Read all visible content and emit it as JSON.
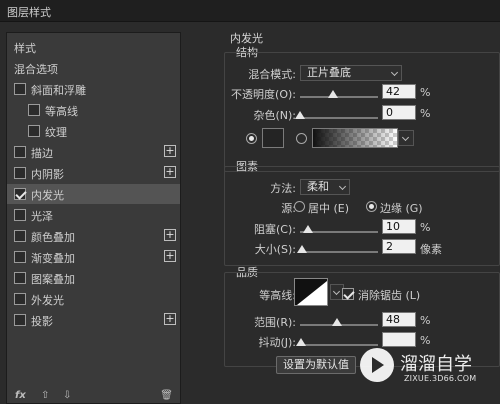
{
  "window": {
    "title": "图层样式"
  },
  "left": {
    "items": [
      {
        "label": "样式",
        "has_checkbox": false,
        "checked": false,
        "has_plus": false,
        "selected": false
      },
      {
        "label": "混合选项",
        "has_checkbox": false,
        "checked": false,
        "has_plus": false,
        "selected": false
      },
      {
        "label": "斜面和浮雕",
        "has_checkbox": true,
        "checked": false,
        "has_plus": false,
        "selected": false
      },
      {
        "label": "等高线",
        "has_checkbox": true,
        "checked": false,
        "has_plus": false,
        "selected": false
      },
      {
        "label": "纹理",
        "has_checkbox": true,
        "checked": false,
        "has_plus": false,
        "selected": false
      },
      {
        "label": "描边",
        "has_checkbox": true,
        "checked": false,
        "has_plus": true,
        "selected": false
      },
      {
        "label": "内阴影",
        "has_checkbox": true,
        "checked": false,
        "has_plus": true,
        "selected": false
      },
      {
        "label": "内发光",
        "has_checkbox": true,
        "checked": true,
        "has_plus": false,
        "selected": true
      },
      {
        "label": "光泽",
        "has_checkbox": true,
        "checked": false,
        "has_plus": false,
        "selected": false
      },
      {
        "label": "颜色叠加",
        "has_checkbox": true,
        "checked": false,
        "has_plus": true,
        "selected": false
      },
      {
        "label": "渐变叠加",
        "has_checkbox": true,
        "checked": false,
        "has_plus": true,
        "selected": false
      },
      {
        "label": "图案叠加",
        "has_checkbox": true,
        "checked": false,
        "has_plus": false,
        "selected": false
      },
      {
        "label": "外发光",
        "has_checkbox": true,
        "checked": false,
        "has_plus": false,
        "selected": false
      },
      {
        "label": "投影",
        "has_checkbox": true,
        "checked": false,
        "has_plus": true,
        "selected": false
      }
    ],
    "footer": {
      "fx": "fx",
      "up": "⇧",
      "down": "⇩",
      "trash": "🗑"
    }
  },
  "right": {
    "title": "内发光",
    "structure": {
      "title": "结构",
      "blend_mode": {
        "label": "混合模式:",
        "value": "正片叠底"
      },
      "opacity": {
        "label": "不透明度(O):",
        "value": "42",
        "unit": "%",
        "fraction": 0.42
      },
      "noise": {
        "label": "杂色(N):",
        "value": "0",
        "unit": "%",
        "fraction": 0.0
      }
    },
    "elements": {
      "title": "图素",
      "method": {
        "label": "方法:",
        "value": "柔和"
      },
      "source": {
        "label": "源:",
        "option_center": "居中 (E)",
        "option_edge": "边缘 (G)",
        "selected": "edge"
      },
      "choke": {
        "label": "阻塞(C):",
        "value": "10",
        "unit": "%",
        "fraction": 0.1
      },
      "size": {
        "label": "大小(S):",
        "value": "2",
        "unit": "像素",
        "fraction": 0.02
      }
    },
    "quality": {
      "title": "品质",
      "contour": {
        "label": "等高线:",
        "anti_alias_label": "消除锯齿 (L)",
        "anti_alias_checked": true
      },
      "range": {
        "label": "范围(R):",
        "value": "48",
        "unit": "%",
        "fraction": 0.48
      },
      "jitter": {
        "label": "抖动(J):",
        "value": "",
        "unit": "%"
      }
    },
    "buttons": {
      "default_label": "设置为默认值"
    }
  },
  "watermark": {
    "title": "溜溜自学",
    "subtitle": "ZIXUE.3D66.COM"
  },
  "colors": {
    "bg": "#2b2b2b",
    "panel": "#3a3a3a",
    "selected": "#545454"
  }
}
